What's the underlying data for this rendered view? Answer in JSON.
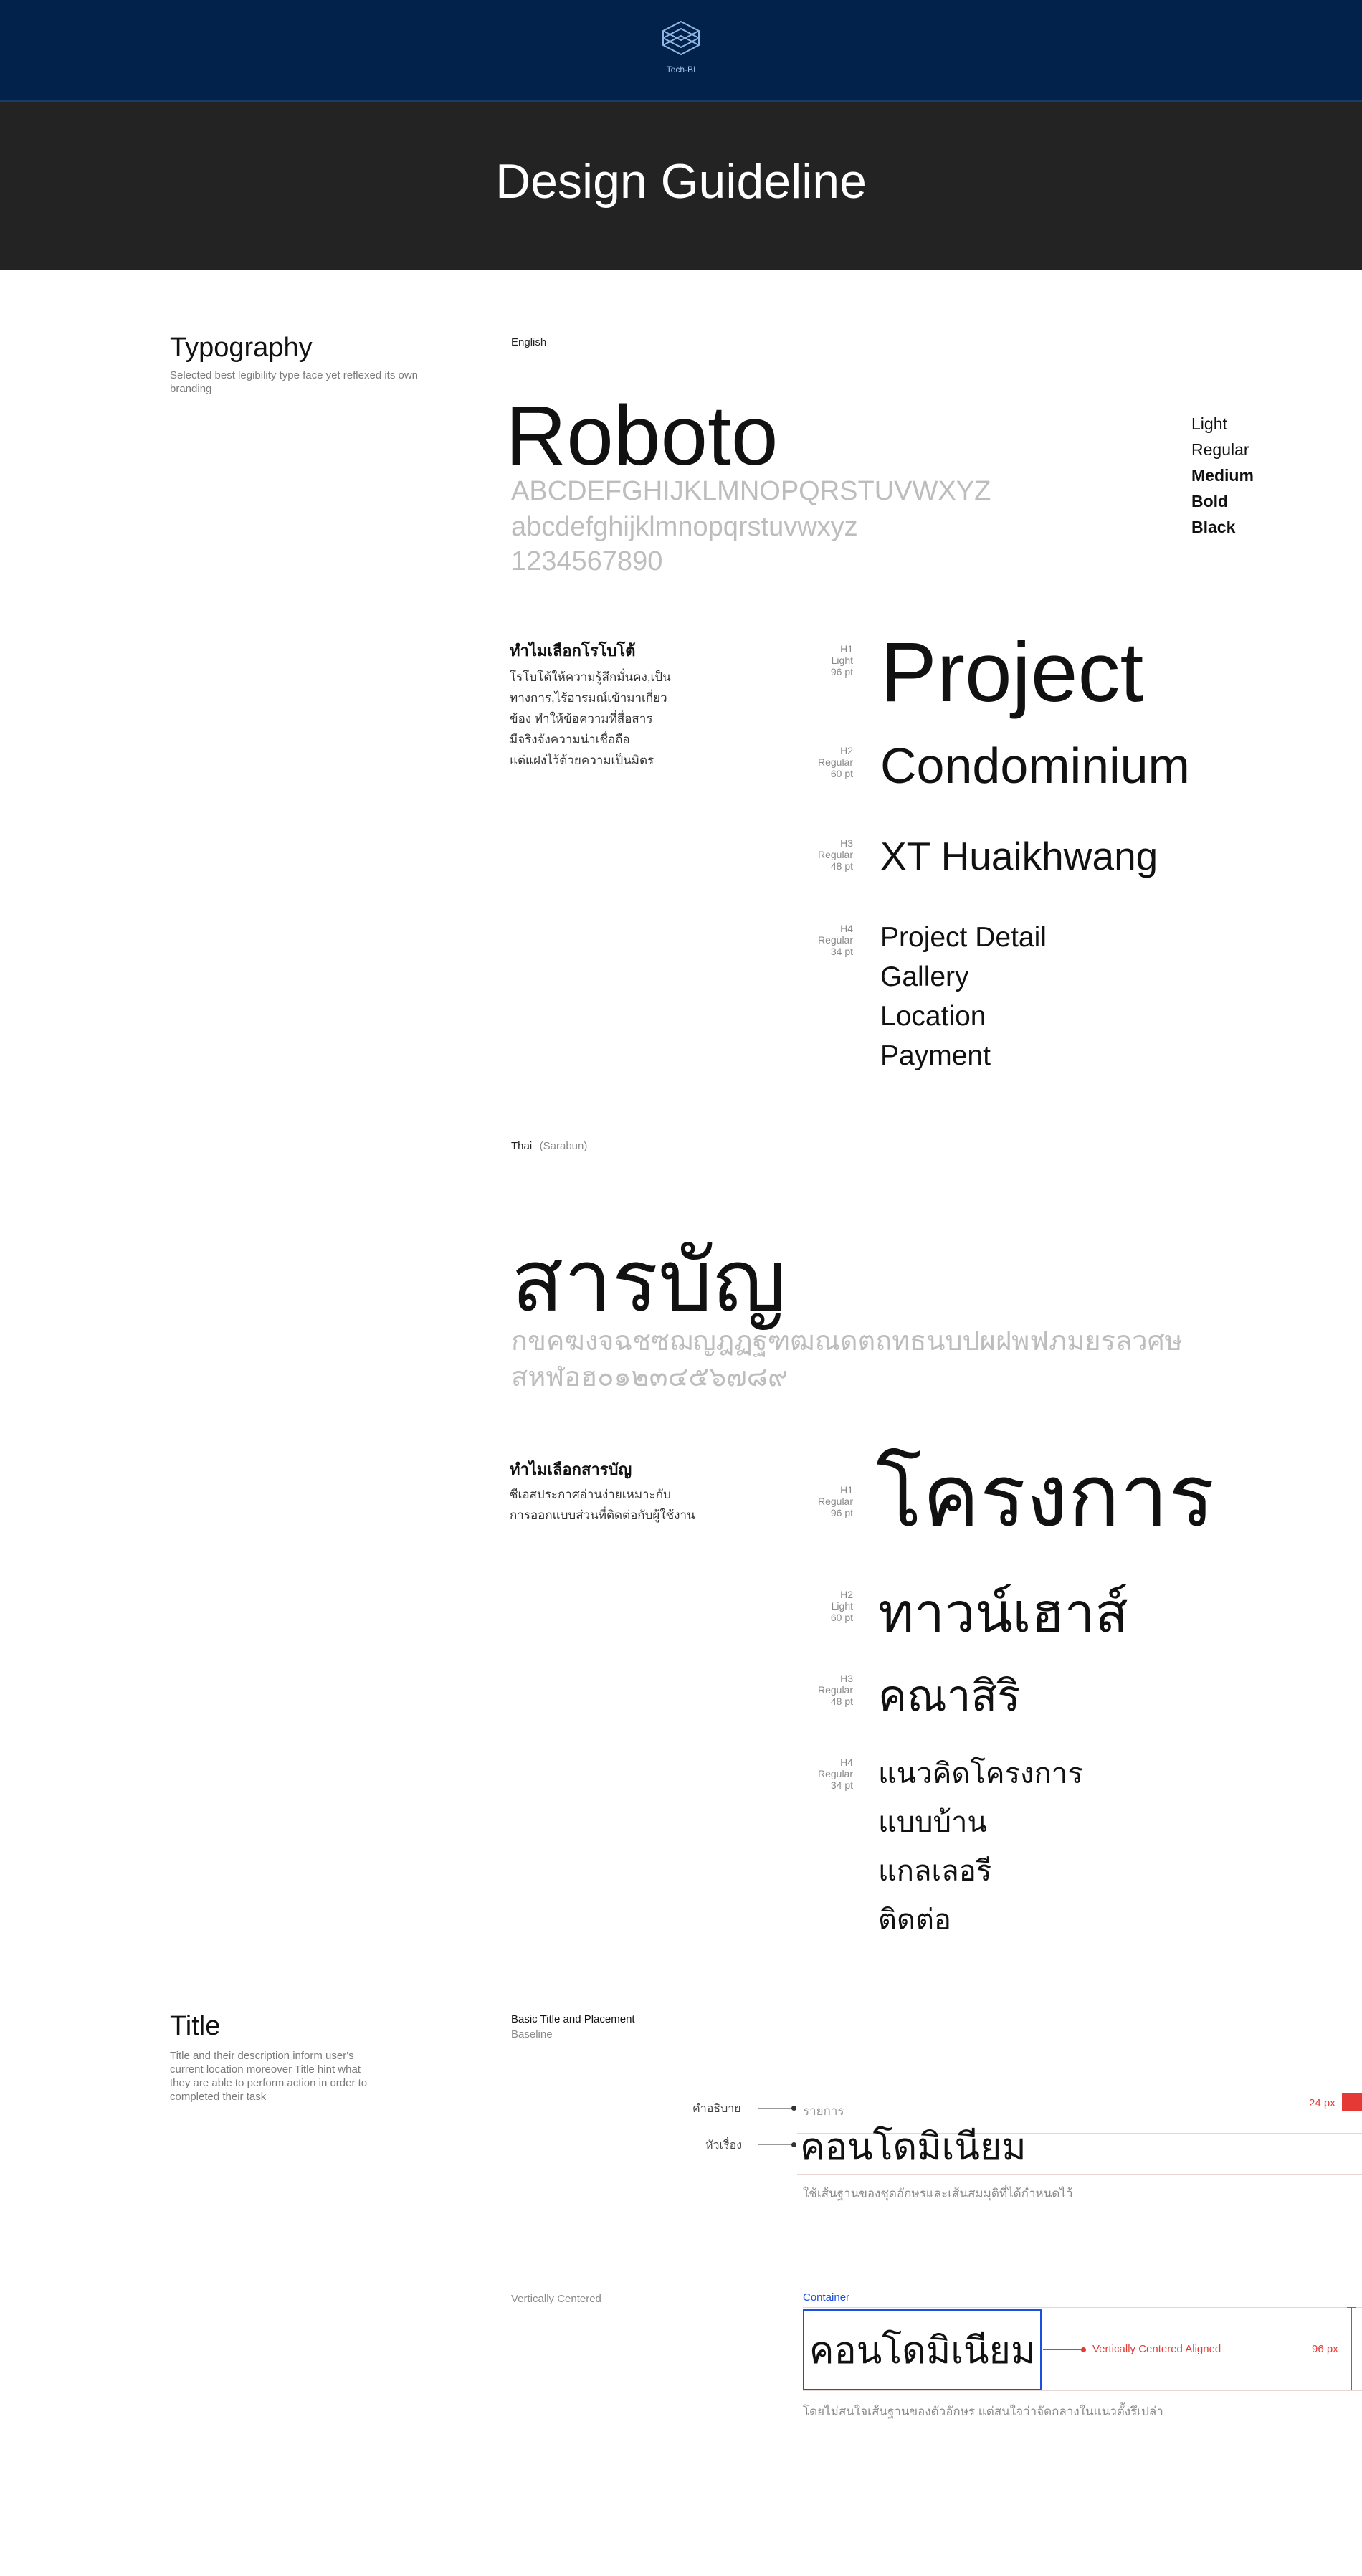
{
  "header": {
    "logo_label": "Tech-BI",
    "banner_title": "Design Guideline"
  },
  "typography": {
    "title": "Typography",
    "description": "Selected best legibility type face yet reflexed its own branding",
    "english": {
      "label": "English",
      "font_name": "Roboto",
      "uppercase": "ABCDEFGHIJKLMNOPQRSTUVWXYZ",
      "lowercase": "abcdefghijklmnopqrstuvwxyz",
      "digits": "1234567890",
      "weights": [
        "Light",
        "Regular",
        "Medium",
        "Bold",
        "Black"
      ],
      "why_title": "ทำไมเลือกโรโบโต้",
      "why_lines": [
        "โรโบโต้ให้ความรู้สึกมั่นคง,เป็น",
        "ทางการ,ไร้อารมณ์เข้ามาเกี่ยว",
        "ข้อง ทำให้ข้อความที่สื่อสาร",
        "มีจริงจังความน่าเชื่อถือ",
        "แต่แฝงไว้ด้วยความเป็นมิตร"
      ],
      "scale": [
        {
          "level": "H1",
          "weight": "Light",
          "size": "96 pt",
          "samples": [
            "Project"
          ]
        },
        {
          "level": "H2",
          "weight": "Regular",
          "size": "60 pt",
          "samples": [
            "Condominium"
          ]
        },
        {
          "level": "H3",
          "weight": "Regular",
          "size": "48 pt",
          "samples": [
            "XT Huaikhwang"
          ]
        },
        {
          "level": "H4",
          "weight": "Regular",
          "size": "34 pt",
          "samples": [
            "Project Detail",
            "Gallery",
            "Location",
            "Payment"
          ]
        }
      ]
    },
    "thai": {
      "label": "Thai",
      "font_note": "(Sarabun)",
      "font_name": "สารบัญ",
      "consonants_1": "กขคฆงจฉชซฌญฎฏฐฑฒณดตถทธนบปผฝพฟภมยรลวศษ",
      "consonants_2": "สหฬอฮ๐๑๒๓๔๕๖๗๘๙",
      "why_title": "ทำไมเลือกสารบัญ",
      "why_lines": [
        "ซีเอสประกาศอ่านง่ายเหมาะกับ",
        "การออกแบบส่วนที่ติดต่อกับผู้ใช้งาน"
      ],
      "scale": [
        {
          "level": "H1",
          "weight": "Regular",
          "size": "96 pt",
          "samples": [
            "โครงการ"
          ]
        },
        {
          "level": "H2",
          "weight": "Light",
          "size": "60 pt",
          "samples": [
            "ทาวน์เฮาส์"
          ]
        },
        {
          "level": "H3",
          "weight": "Regular",
          "size": "48 pt",
          "samples": [
            "คณาสิริ"
          ]
        },
        {
          "level": "H4",
          "weight": "Regular",
          "size": "34 pt",
          "samples": [
            "แนวคิดโครงการ",
            "แบบบ้าน",
            "แกลเลอรี",
            "ติดต่อ"
          ]
        }
      ]
    }
  },
  "title_section": {
    "title": "Title",
    "description": "Title and their description inform user's current location moreover Title hint what they are able to perform action in order to completed their task",
    "basic": {
      "heading": "Basic Title and Placement",
      "sub": "Baseline",
      "caption_label": "คำอธิบาย",
      "caption_text": "รายการ",
      "heading_label": "หัวเรื่อง",
      "heading_text": "คอนโดมิเนียม",
      "measure": "24 px",
      "note": "ใช้เส้นฐานของชุดอักษรและเส้นสมมุติที่ได้กำหนดไว้"
    },
    "centered": {
      "label": "Vertically Centered",
      "container_label": "Container",
      "heading_text": "คอนโดมิเนียม",
      "annotation": "Vertically Centered Aligned",
      "measure": "96 px",
      "note": "โดยไม่สนใจเส้นฐานของตัวอักษร แต่สนใจว่าจัดกลางในแนวตั้งรึเปล่า"
    }
  },
  "colors": {
    "header_bg": "#03224b",
    "banner_bg": "#232323",
    "accent_red": "#e53935",
    "accent_blue": "#1a4fe0"
  }
}
